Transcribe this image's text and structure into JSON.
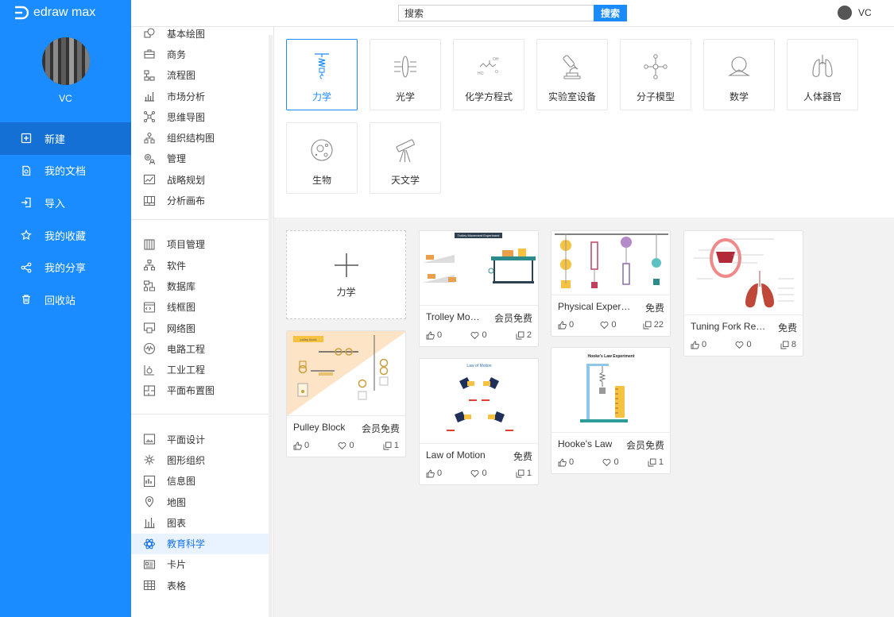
{
  "app": {
    "name": "edraw max"
  },
  "user": {
    "name": "VC"
  },
  "search": {
    "placeholder": "搜索",
    "button": "搜索"
  },
  "nav": [
    {
      "label": "新建",
      "icon": "new-file-icon",
      "active": true
    },
    {
      "label": "我的文档",
      "icon": "documents-icon"
    },
    {
      "label": "导入",
      "icon": "import-icon"
    },
    {
      "label": "我的收藏",
      "icon": "star-icon"
    },
    {
      "label": "我的分享",
      "icon": "share-icon"
    },
    {
      "label": "回收站",
      "icon": "trash-icon"
    }
  ],
  "categories": {
    "group1": [
      {
        "label": "基本绘图",
        "icon": "basic-shapes-icon"
      },
      {
        "label": "商务",
        "icon": "briefcase-icon"
      },
      {
        "label": "流程图",
        "icon": "flowchart-icon"
      },
      {
        "label": "市场分析",
        "icon": "bar-chart-icon"
      },
      {
        "label": "思维导图",
        "icon": "mindmap-icon"
      },
      {
        "label": "组织结构图",
        "icon": "org-chart-icon"
      },
      {
        "label": "管理",
        "icon": "gear-people-icon"
      },
      {
        "label": "战略规划",
        "icon": "strategy-chart-icon"
      },
      {
        "label": "分析画布",
        "icon": "canvas-grid-icon"
      }
    ],
    "group2": [
      {
        "label": "项目管理",
        "icon": "gantt-icon"
      },
      {
        "label": "软件",
        "icon": "software-icon"
      },
      {
        "label": "数据库",
        "icon": "database-icon"
      },
      {
        "label": "线框图",
        "icon": "wireframe-icon"
      },
      {
        "label": "网络图",
        "icon": "network-icon"
      },
      {
        "label": "电路工程",
        "icon": "circuit-icon"
      },
      {
        "label": "工业工程",
        "icon": "industrial-icon"
      },
      {
        "label": "平面布置图",
        "icon": "floor-plan-icon"
      }
    ],
    "group3": [
      {
        "label": "平面设计",
        "icon": "graphic-design-icon"
      },
      {
        "label": "图形组织",
        "icon": "graphic-organizer-icon"
      },
      {
        "label": "信息图",
        "icon": "infographic-icon"
      },
      {
        "label": "地图",
        "icon": "map-pin-icon"
      },
      {
        "label": "图表",
        "icon": "chart-icon"
      },
      {
        "label": "教育科学",
        "icon": "atom-icon",
        "active": true
      },
      {
        "label": "卡片",
        "icon": "card-icon"
      },
      {
        "label": "表格",
        "icon": "table-icon"
      }
    ]
  },
  "subcategories": [
    {
      "label": "力学",
      "icon": "spring-icon",
      "active": true
    },
    {
      "label": "光学",
      "icon": "lens-icon"
    },
    {
      "label": "化学方程式",
      "icon": "chemical-formula-icon"
    },
    {
      "label": "实验室设备",
      "icon": "microscope-icon"
    },
    {
      "label": "分子模型",
      "icon": "molecule-icon"
    },
    {
      "label": "数学",
      "icon": "geometry-icon"
    },
    {
      "label": "人体器官",
      "icon": "lungs-icon"
    },
    {
      "label": "生物",
      "icon": "cell-icon"
    },
    {
      "label": "天文学",
      "icon": "telescope-icon"
    }
  ],
  "new_template": {
    "label": "力学"
  },
  "templates": [
    {
      "name": "Pulley Block",
      "badge": "会员免费",
      "likes": "0",
      "favorites": "0",
      "copies": "1",
      "thumb_title": "pulley block"
    },
    {
      "name": "Trolley Movement Experiment",
      "badge": "会员免费",
      "likes": "0",
      "favorites": "0",
      "copies": "2",
      "thumb_title": "Trolley Movement Experiment"
    },
    {
      "name": "Law of Motion",
      "badge": "免费",
      "likes": "0",
      "favorites": "0",
      "copies": "1",
      "thumb_title": "Law of Motion"
    },
    {
      "name": "Physical Experiment",
      "badge": "免费",
      "likes": "0",
      "favorites": "0",
      "copies": "22"
    },
    {
      "name": "Hooke's Law",
      "badge": "会员免费",
      "likes": "0",
      "favorites": "0",
      "copies": "1",
      "thumb_title": "Hooke's Law Experiment"
    },
    {
      "name": "Tuning Fork Resonance",
      "badge": "免费",
      "likes": "0",
      "favorites": "0",
      "copies": "8"
    }
  ],
  "colors": {
    "primary": "#1a8cff",
    "nav_active": "#1470d4",
    "accent_light": "#e9f3ff"
  }
}
